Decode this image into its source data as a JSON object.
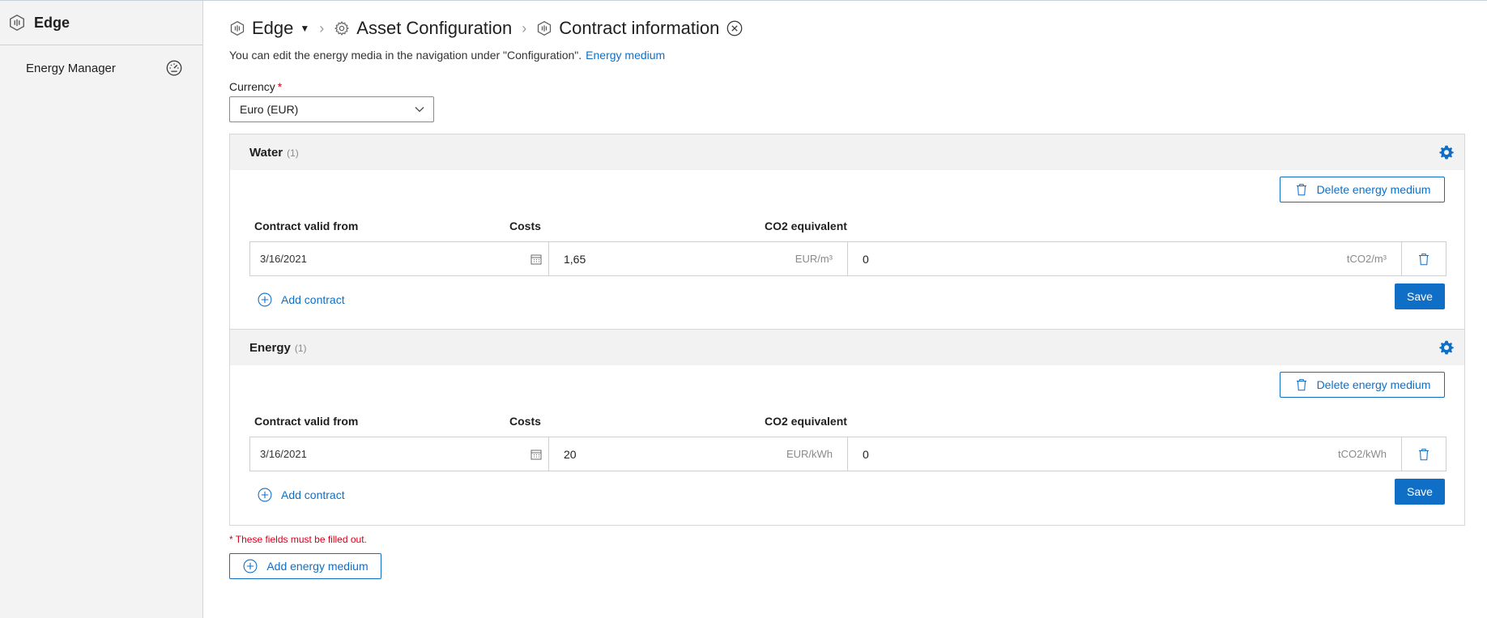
{
  "sidebar": {
    "title": "Edge",
    "items": [
      {
        "label": "Energy Manager",
        "icon": "gauge-icon"
      }
    ]
  },
  "breadcrumb": {
    "items": [
      {
        "label": "Edge",
        "icon": "edge-app-icon"
      },
      {
        "label": "Asset Configuration",
        "icon": "gear-icon"
      },
      {
        "label": "Contract information",
        "icon": "edge-app-icon"
      }
    ]
  },
  "info": {
    "text": "You can edit the energy media in the navigation under \"Configuration\".",
    "link": "Energy medium"
  },
  "currency": {
    "label": "Currency",
    "required_mark": "*",
    "value": "Euro (EUR)"
  },
  "columns": {
    "valid_from": "Contract valid from",
    "costs": "Costs",
    "co2": "CO2 equivalent"
  },
  "sections": [
    {
      "title": "Water",
      "count": "(1)",
      "delete_label": "Delete energy medium",
      "contracts": [
        {
          "valid_from": "3/16/2021",
          "costs": "1,65",
          "costs_unit": "EUR/m³",
          "co2": "0",
          "co2_unit": "tCO2/m³"
        }
      ],
      "add_contract_label": "Add contract",
      "save_label": "Save"
    },
    {
      "title": "Energy",
      "count": "(1)",
      "delete_label": "Delete energy medium",
      "contracts": [
        {
          "valid_from": "3/16/2021",
          "costs": "20",
          "costs_unit": "EUR/kWh",
          "co2": "0",
          "co2_unit": "tCO2/kWh"
        }
      ],
      "add_contract_label": "Add contract",
      "save_label": "Save"
    }
  ],
  "footer": {
    "required_note": "* These fields must be filled out.",
    "add_medium_label": "Add energy medium"
  },
  "colors": {
    "accent": "#0f6fc6",
    "required": "#d6001c",
    "section_bg": "#f2f2f2"
  }
}
